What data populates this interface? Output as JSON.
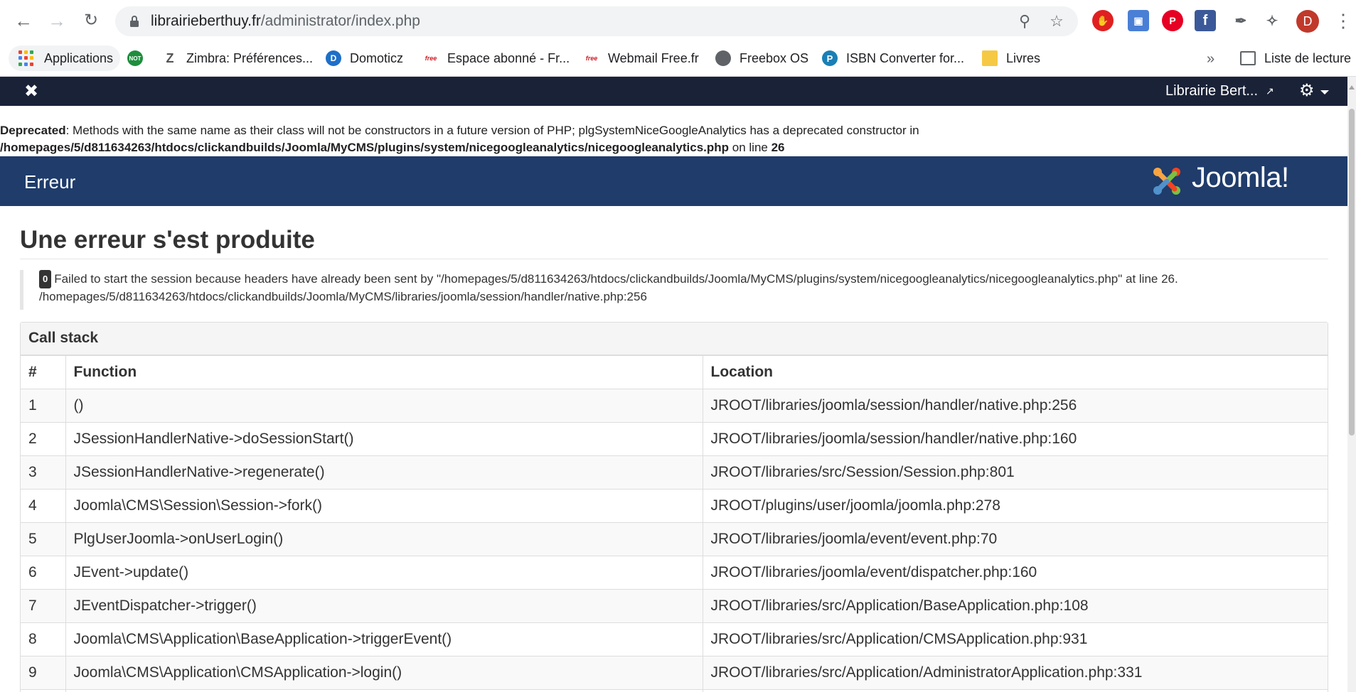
{
  "browser": {
    "url_domain": "librairieberthuy.fr",
    "url_path": "/administrator/index.php",
    "avatar_letter": "D",
    "bookmarks": [
      {
        "label": "Applications"
      },
      {
        "label": "Zimbra: Préférences..."
      },
      {
        "label": "Domoticz"
      },
      {
        "label": "Espace abonné - Fr..."
      },
      {
        "label": "Webmail Free.fr"
      },
      {
        "label": "Freebox OS"
      },
      {
        "label": "ISBN Converter for..."
      },
      {
        "label": "Livres"
      }
    ],
    "more_label": "»",
    "reading_list_label": "Liste de lecture"
  },
  "admin_bar": {
    "site_name": "Librairie Bert..."
  },
  "deprecated": {
    "label": "Deprecated",
    "message": ": Methods with the same name as their class will not be constructors in a future version of PHP; plgSystemNiceGoogleAnalytics has a deprecated constructor in",
    "path": "/homepages/5/d811634263/htdocs/clickandbuilds/Joomla/MyCMS/plugins/system/nicegoogleanalytics/nicegoogleanalytics.php",
    "on_line": " on line ",
    "line": "26"
  },
  "error_bar": {
    "title": "Erreur",
    "logo_text": "Joomla!"
  },
  "error": {
    "heading": "Une erreur s'est produite",
    "code": "0",
    "message": "Failed to start the session because headers have already been sent by \"/homepages/5/d811634263/htdocs/clickandbuilds/Joomla/MyCMS/plugins/system/nicegoogleanalytics/nicegoogleanalytics.php\" at line 26.",
    "file": "/homepages/5/d811634263/htdocs/clickandbuilds/Joomla/MyCMS/libraries/joomla/session/handler/native.php:256"
  },
  "callstack": {
    "heading": "Call stack",
    "columns": [
      "#",
      "Function",
      "Location"
    ],
    "rows": [
      {
        "n": "1",
        "function": "()",
        "location": "JROOT/libraries/joomla/session/handler/native.php:256"
      },
      {
        "n": "2",
        "function": "JSessionHandlerNative->doSessionStart()",
        "location": "JROOT/libraries/joomla/session/handler/native.php:160"
      },
      {
        "n": "3",
        "function": "JSessionHandlerNative->regenerate()",
        "location": "JROOT/libraries/src/Session/Session.php:801"
      },
      {
        "n": "4",
        "function": "Joomla\\CMS\\Session\\Session->fork()",
        "location": "JROOT/plugins/user/joomla/joomla.php:278"
      },
      {
        "n": "5",
        "function": "PlgUserJoomla->onUserLogin()",
        "location": "JROOT/libraries/joomla/event/event.php:70"
      },
      {
        "n": "6",
        "function": "JEvent->update()",
        "location": "JROOT/libraries/joomla/event/dispatcher.php:160"
      },
      {
        "n": "7",
        "function": "JEventDispatcher->trigger()",
        "location": "JROOT/libraries/src/Application/BaseApplication.php:108"
      },
      {
        "n": "8",
        "function": "Joomla\\CMS\\Application\\BaseApplication->triggerEvent()",
        "location": "JROOT/libraries/src/Application/CMSApplication.php:931"
      },
      {
        "n": "9",
        "function": "Joomla\\CMS\\Application\\CMSApplication->login()",
        "location": "JROOT/libraries/src/Application/AdministratorApplication.php:331"
      },
      {
        "n": "",
        "function": "",
        "location": ""
      }
    ]
  }
}
